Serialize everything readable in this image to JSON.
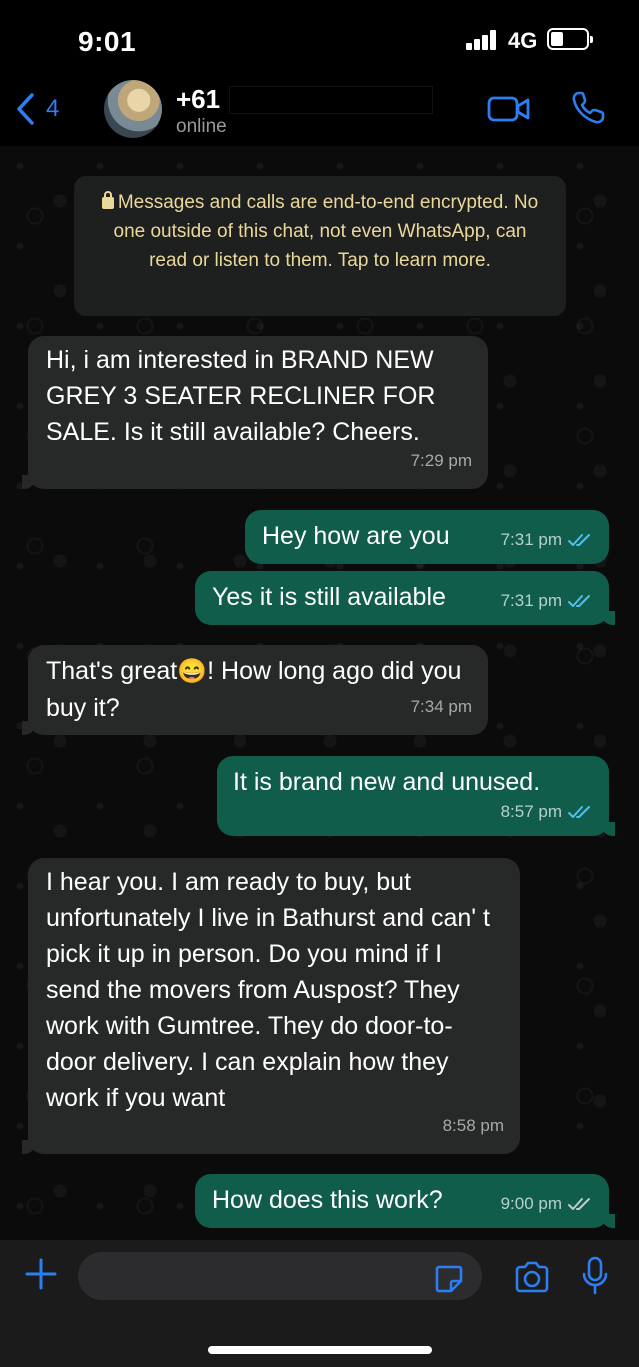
{
  "status_bar": {
    "time": "9:01",
    "network": "4G"
  },
  "header": {
    "back_count": "4",
    "contact_name": "+61",
    "contact_status": "online"
  },
  "encryption_notice": "Messages and calls are end-to-end encrypted. No one outside of this chat, not even WhatsApp, can read or listen to them. Tap to learn more.",
  "messages": [
    {
      "direction": "incoming",
      "text": "Hi, i am interested in BRAND NEW GREY 3 SEATER RECLINER FOR SALE. Is it still available? Cheers.",
      "time": "7:29 pm"
    },
    {
      "direction": "outgoing",
      "text": "Hey how are you",
      "time": "7:31 pm",
      "status": "read"
    },
    {
      "direction": "outgoing",
      "text": "Yes it is still available",
      "time": "7:31 pm",
      "status": "read"
    },
    {
      "direction": "incoming",
      "text_before_emoji": "That's great",
      "emoji": "😄",
      "text_after_emoji": "! How long ago did you buy it?",
      "time": "7:34 pm"
    },
    {
      "direction": "outgoing",
      "text": "It is brand new and unused.",
      "time": "8:57 pm",
      "status": "read"
    },
    {
      "direction": "incoming",
      "text": "I hear you. I am ready to buy, but unfortunately I live in Bathurst and can' t pick it up in person. Do you mind if I send the movers from Auspost? They work with Gumtree. They do door-to-door delivery. I can explain how they work if you want",
      "time": "8:58 pm"
    },
    {
      "direction": "outgoing",
      "text": "How does this work?",
      "time": "9:00 pm",
      "status": "delivered"
    }
  ],
  "input": {
    "placeholder": ""
  },
  "colors": {
    "accent": "#2b7ff2",
    "incoming_bubble": "#272828",
    "outgoing_bubble": "#115d4c",
    "notice_text": "#ead89b",
    "read_tick": "#53bdeb",
    "delivered_tick": "#b7d1c9"
  },
  "icons": [
    "back-chevron-icon",
    "video-call-icon",
    "phone-icon",
    "lock-icon",
    "double-check-icon",
    "plus-icon",
    "sticker-icon",
    "camera-icon",
    "microphone-icon"
  ]
}
